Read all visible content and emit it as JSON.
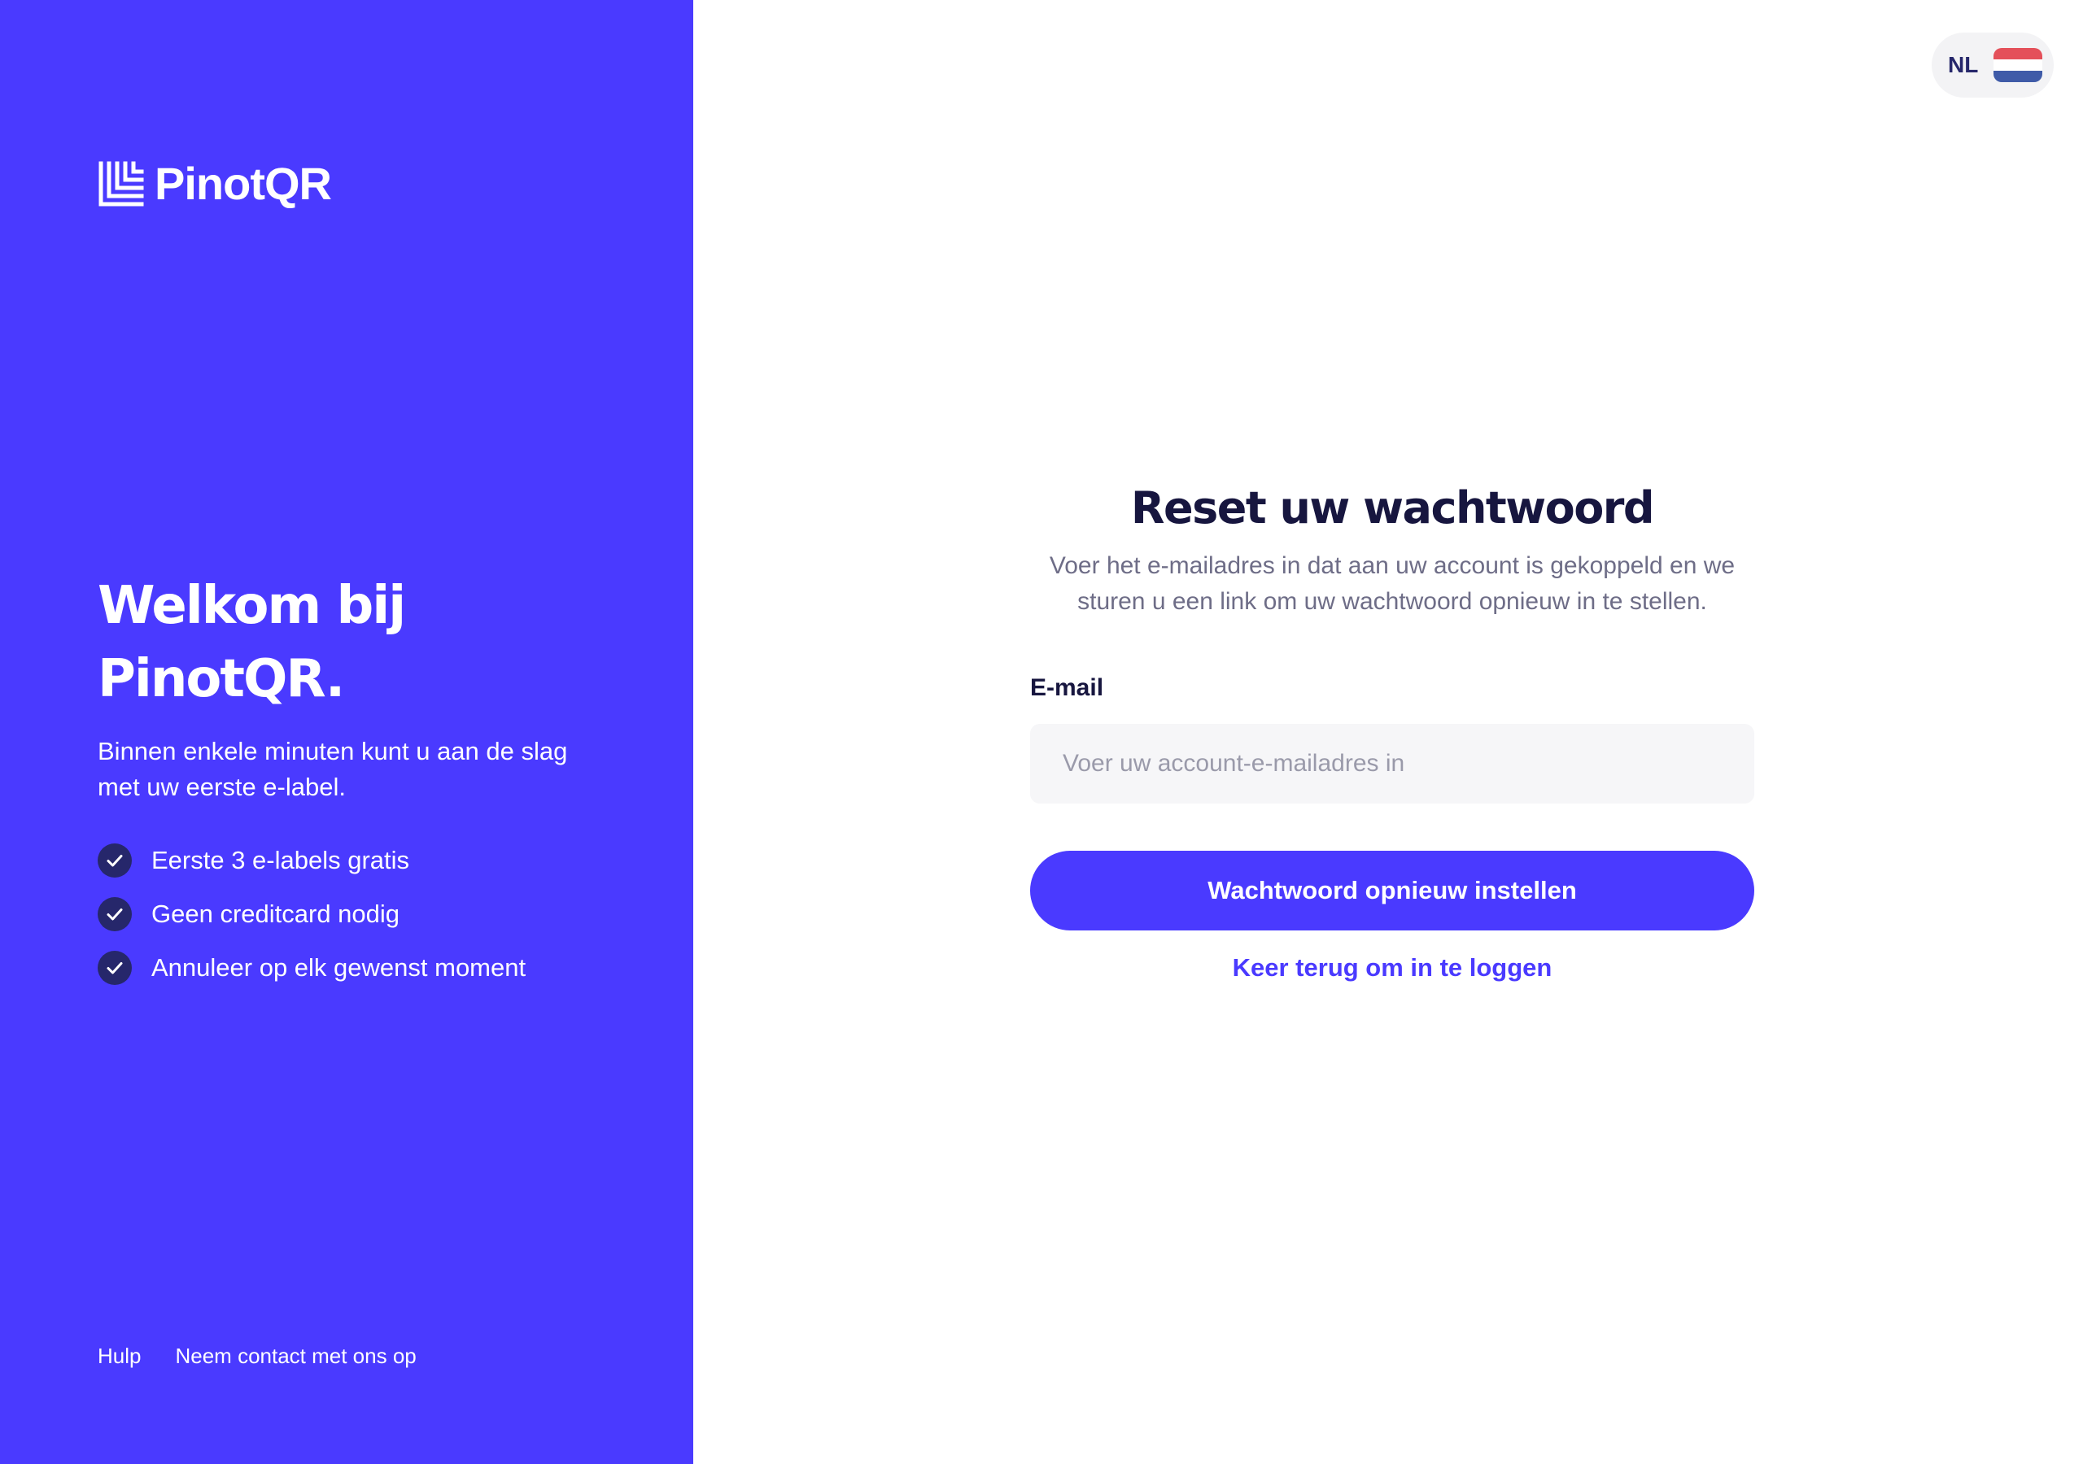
{
  "brand": {
    "name": "PinotQR",
    "accent_color": "#4a3aff",
    "dark_color": "#17163f"
  },
  "left_panel": {
    "title_line1": "Welkom bij",
    "title_line2": "PinotQR.",
    "subtitle": "Binnen enkele minuten kunt u aan de slag met uw eerste e-label.",
    "benefits": [
      {
        "icon": "check-icon",
        "label": "Eerste 3 e-labels gratis"
      },
      {
        "icon": "check-icon",
        "label": "Geen creditcard nodig"
      },
      {
        "icon": "check-icon",
        "label": "Annuleer op elk gewenst moment"
      }
    ],
    "footer_links": [
      {
        "label": "Hulp"
      },
      {
        "label": "Neem contact met ons op"
      }
    ]
  },
  "language": {
    "code": "NL",
    "flag": "netherlands-flag-icon",
    "flag_colors": [
      "#e4505a",
      "#ffffff",
      "#3f5ba8"
    ]
  },
  "form": {
    "title": "Reset uw wachtwoord",
    "description": "Voer het e-mailadres in dat aan uw account is gekoppeld en we sturen u een link om uw wachtwoord opnieuw in te stellen.",
    "email_label": "E-mail",
    "email_value": "",
    "email_placeholder": "Voer uw account-e-mailadres in",
    "submit_label": "Wachtwoord opnieuw instellen",
    "back_link_label": "Keer terug om in te loggen"
  }
}
